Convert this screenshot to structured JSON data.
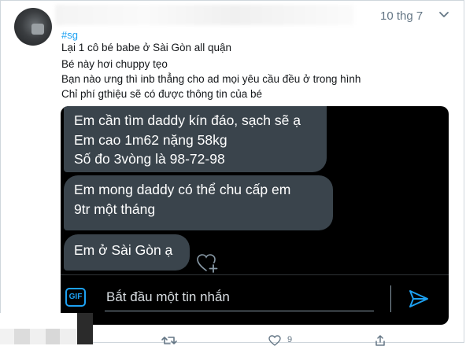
{
  "tweet": {
    "hashtag": "#sg",
    "date": "10 thg 7",
    "lines": [
      "Lại 1 cô bé babe ở Sài Gòn all quận",
      "Bé này hơi chuppy tẹo",
      "Bạn nào ưng thì inb thẳng cho ad mọi yêu cầu đều ở trong hình",
      "Chỉ phí gthiệu sẽ có được thông tin của bé"
    ],
    "like_count": "9"
  },
  "chat": {
    "bubbles": [
      [
        "Em cần tìm daddy kín đáo, sạch sẽ ạ",
        "Em cao 1m62 nặng 58kg",
        "Số đo 3vòng là 98-72-98"
      ],
      [
        "Em mong daddy có thể chu cấp em",
        "9tr một tháng"
      ],
      [
        "Em ở Sài Gòn ạ"
      ]
    ],
    "gif_label": "GIF",
    "input_placeholder": "Bắt đầu một tin nhắn"
  },
  "colors": {
    "accent": "#1da1f2",
    "bubble": "#3a444c",
    "chat_bg": "#000000",
    "muted": "#657786"
  },
  "icons": [
    "more-icon",
    "heart-add-icon",
    "gif-icon",
    "send-icon",
    "retweet-icon",
    "like-icon",
    "share-icon"
  ]
}
